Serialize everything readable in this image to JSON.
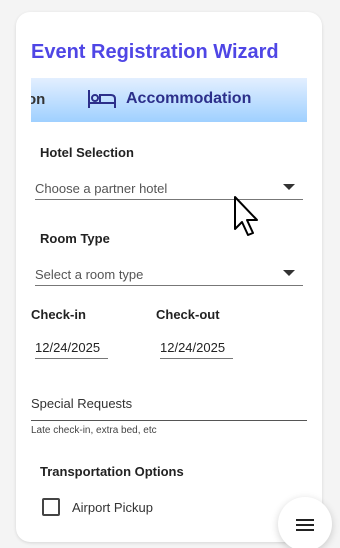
{
  "wizard": {
    "title": "Event Registration Wizard",
    "previous_step_partial": "on",
    "current_step": "Accommodation",
    "current_step_icon": "bed-icon"
  },
  "form": {
    "hotel_selection": {
      "label": "Hotel Selection",
      "placeholder": "Choose a partner hotel"
    },
    "room_type": {
      "label": "Room Type",
      "placeholder": "Select a room type"
    },
    "check_in": {
      "label": "Check-in",
      "value": "12/24/2025"
    },
    "check_out": {
      "label": "Check-out",
      "value": "12/24/2025"
    },
    "special_requests": {
      "placeholder": "Special Requests",
      "helper": "Late check-in, extra bed, etc"
    },
    "transportation": {
      "label": "Transportation Options",
      "airport_pickup_label": "Airport Pickup",
      "airport_pickup_checked": false
    }
  },
  "fab": {
    "icon": "menu-icon"
  },
  "colors": {
    "title": "#4f46e5",
    "step_banner_top": "#e3efff",
    "step_banner_bottom": "#9fd0ff",
    "step_text": "#2c2f8a"
  }
}
